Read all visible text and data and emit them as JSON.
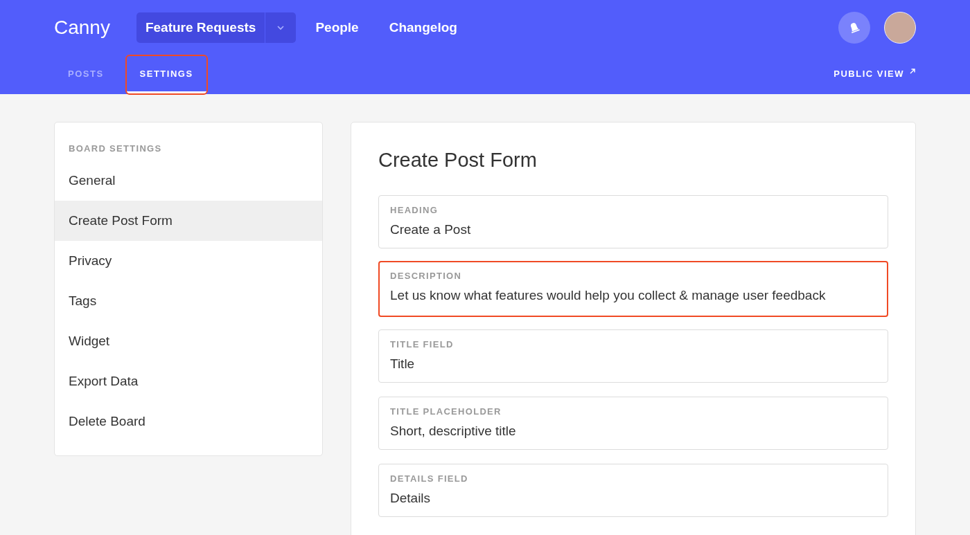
{
  "header": {
    "logo": "Canny",
    "board_selector": {
      "label": "Feature Requests"
    },
    "nav_links": [
      "People",
      "Changelog"
    ]
  },
  "tabs": [
    {
      "label": "POSTS",
      "selected": false,
      "highlighted": false
    },
    {
      "label": "SETTINGS",
      "selected": true,
      "highlighted": true
    }
  ],
  "public_view": "PUBLIC VIEW",
  "sidebar": {
    "heading": "BOARD SETTINGS",
    "items": [
      {
        "label": "General",
        "selected": false
      },
      {
        "label": "Create Post Form",
        "selected": true
      },
      {
        "label": "Privacy",
        "selected": false
      },
      {
        "label": "Tags",
        "selected": false
      },
      {
        "label": "Widget",
        "selected": false
      },
      {
        "label": "Export Data",
        "selected": false
      },
      {
        "label": "Delete Board",
        "selected": false
      }
    ]
  },
  "form": {
    "title": "Create Post Form",
    "fields": [
      {
        "label": "HEADING",
        "value": "Create a Post",
        "highlighted": false
      },
      {
        "label": "DESCRIPTION",
        "value": "Let us know what features would help you collect & manage user feedback",
        "highlighted": true
      },
      {
        "label": "TITLE FIELD",
        "value": "Title",
        "highlighted": false
      },
      {
        "label": "TITLE PLACEHOLDER",
        "value": "Short, descriptive title",
        "highlighted": false
      },
      {
        "label": "DETAILS FIELD",
        "value": "Details",
        "highlighted": false
      }
    ]
  }
}
